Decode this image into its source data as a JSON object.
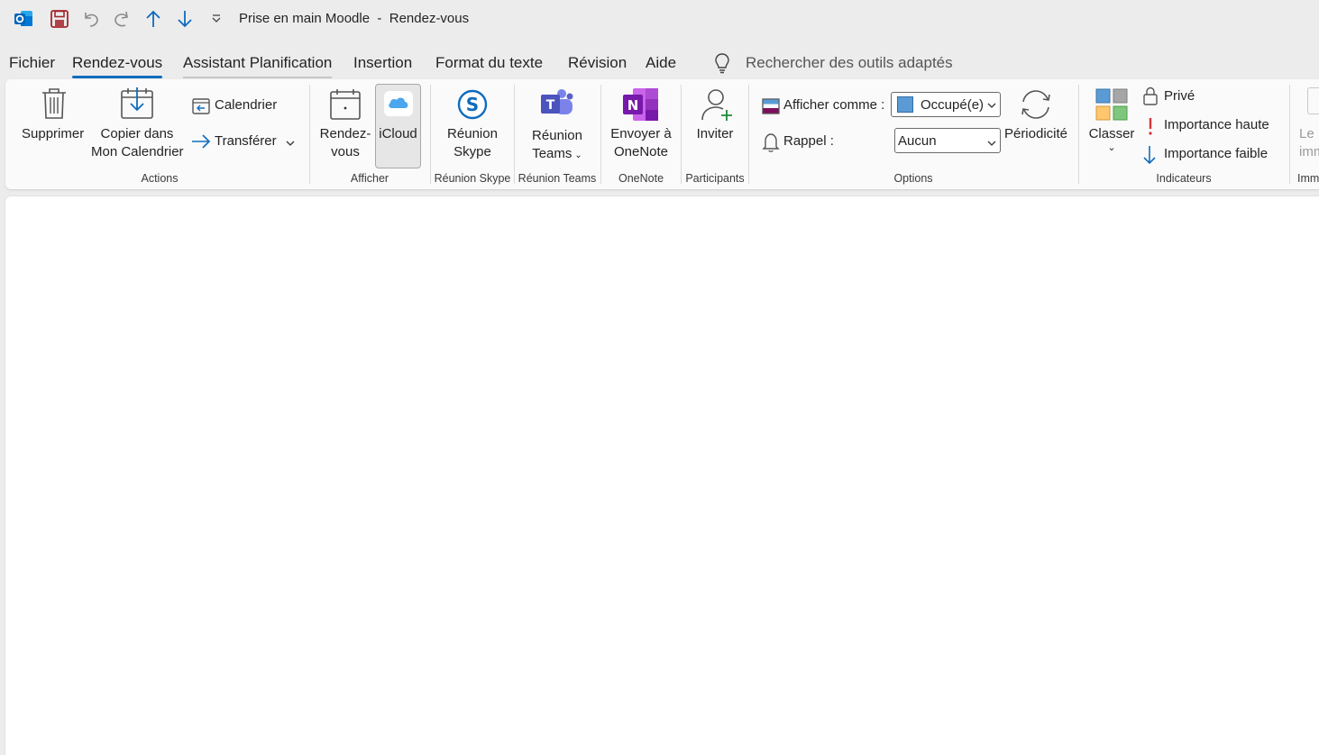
{
  "window": {
    "title": "Prise en main Moodle  -  Rendez-vous"
  },
  "menu": {
    "tabs": [
      {
        "label": "Fichier"
      },
      {
        "label": "Rendez-vous",
        "active": true
      },
      {
        "label": "Assistant Planification"
      },
      {
        "label": "Insertion"
      },
      {
        "label": "Format du texte"
      },
      {
        "label": "Révision"
      },
      {
        "label": "Aide"
      }
    ],
    "search_label": "Rechercher des outils adaptés"
  },
  "ribbon": {
    "actions": {
      "delete": "Supprimer",
      "copy_line1": "Copier dans",
      "copy_line2": "Mon Calendrier",
      "calendar": "Calendrier",
      "forward": "Transférer",
      "group": "Actions"
    },
    "show": {
      "appointment_line1": "Rendez-",
      "appointment_line2": "vous",
      "icloud": "iCloud",
      "group": "Afficher"
    },
    "skype": {
      "line1": "Réunion",
      "line2": "Skype",
      "group": "Réunion Skype"
    },
    "teams": {
      "line1": "Réunion",
      "line2": "Teams",
      "group": "Réunion Teams"
    },
    "onenote": {
      "line1": "Envoyer à",
      "line2": "OneNote",
      "group": "OneNote"
    },
    "attendees": {
      "invite": "Inviter",
      "group": "Participants"
    },
    "options": {
      "show_as_label": "Afficher comme :",
      "show_as_value": "Occupé(e)",
      "reminder_label": "Rappel :",
      "reminder_value": "Aucun",
      "recurrence": "Périodicité",
      "group": "Options"
    },
    "tags": {
      "categorize": "Classer",
      "private": "Privé",
      "high_importance": "Importance haute",
      "low_importance": "Importance faible",
      "group": "Indicateurs"
    },
    "clipped": {
      "line1": "Le",
      "line2": "imm",
      "group": "Imm"
    }
  },
  "colors": {
    "accent": "#0f6cbd",
    "busy": "#5b9bd5",
    "high_importance": "#d13438",
    "teams": "#5b5fc7",
    "onenote": "#7719aa",
    "save": "#a4262c"
  }
}
